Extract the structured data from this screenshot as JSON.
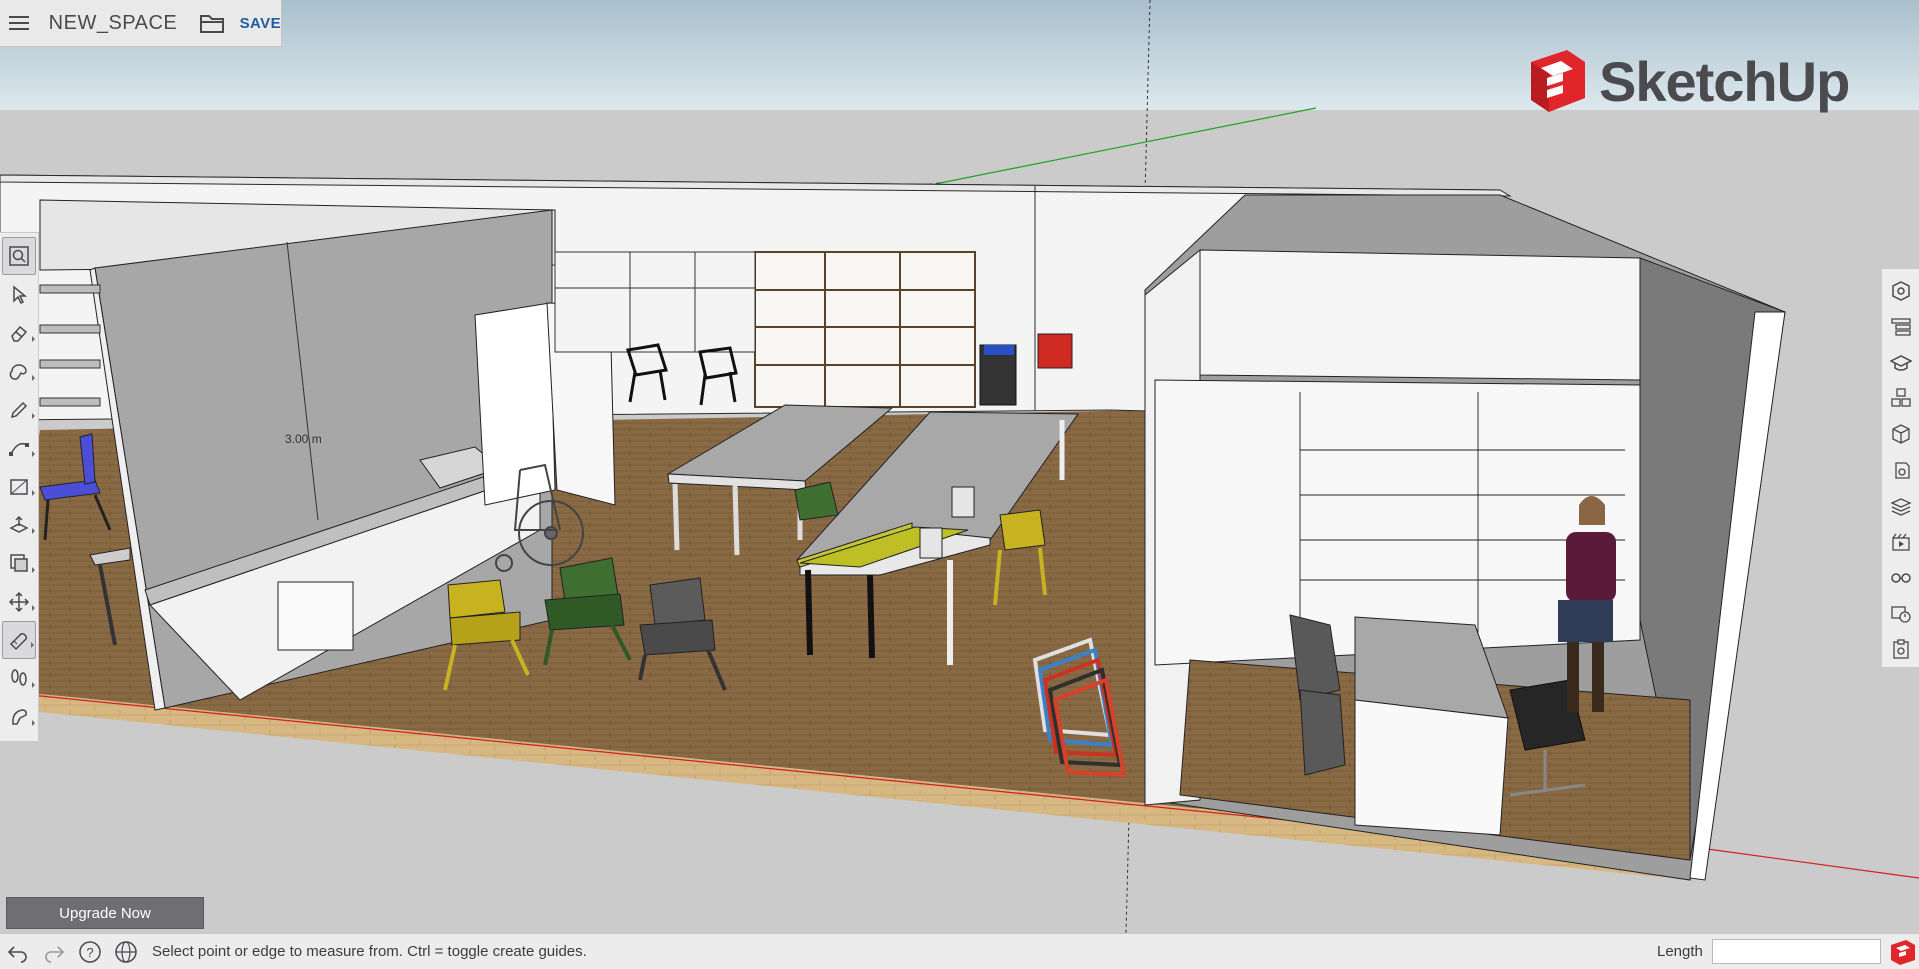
{
  "file": {
    "name": "NEW_SPACE",
    "save_label": "SAVE"
  },
  "brand": {
    "logo_text": "SketchUp",
    "accent_color": "#e0262b"
  },
  "scene": {
    "dimension_label": "3.00 m"
  },
  "left_toolbar": {
    "tools": [
      {
        "name": "search-tool",
        "icon": "search-icon",
        "active": true
      },
      {
        "name": "select-tool",
        "icon": "arrow-icon",
        "active": false
      },
      {
        "name": "eraser-tool",
        "icon": "eraser-icon",
        "active": false
      },
      {
        "name": "paint-tool",
        "icon": "paint-bucket-icon",
        "active": false
      },
      {
        "name": "line-tool",
        "icon": "pencil-icon",
        "active": false
      },
      {
        "name": "arc-tool",
        "icon": "arc-icon",
        "active": false
      },
      {
        "name": "rectangle-tool",
        "icon": "rectangle-icon",
        "active": false
      },
      {
        "name": "push-pull-tool",
        "icon": "push-pull-icon",
        "active": false
      },
      {
        "name": "offset-tool",
        "icon": "offset-icon",
        "active": false
      },
      {
        "name": "move-tool",
        "icon": "move-icon",
        "active": false
      },
      {
        "name": "tape-measure-tool",
        "icon": "tape-measure-icon",
        "active": true
      },
      {
        "name": "walk-tool",
        "icon": "footprints-icon",
        "active": false
      },
      {
        "name": "orbit-tool",
        "icon": "orbit-icon",
        "active": false
      }
    ]
  },
  "right_panel": {
    "items": [
      {
        "name": "entity-info-panel",
        "icon": "entity-info-icon"
      },
      {
        "name": "outliner-panel",
        "icon": "outliner-icon"
      },
      {
        "name": "instructor-panel",
        "icon": "instructor-icon"
      },
      {
        "name": "components-panel",
        "icon": "components-icon"
      },
      {
        "name": "materials-panel",
        "icon": "materials-icon"
      },
      {
        "name": "styles-panel",
        "icon": "styles-icon"
      },
      {
        "name": "tags-panel",
        "icon": "layers-icon"
      },
      {
        "name": "scenes-panel",
        "icon": "scenes-icon"
      },
      {
        "name": "display-panel",
        "icon": "glasses-icon"
      },
      {
        "name": "view-panel",
        "icon": "camera-icon"
      },
      {
        "name": "solar-panel",
        "icon": "report-icon"
      }
    ]
  },
  "upgrade": {
    "label": "Upgrade Now"
  },
  "status": {
    "hint": "Select point or edge to measure from. Ctrl = toggle create guides.",
    "length_label": "Length",
    "length_value": ""
  }
}
